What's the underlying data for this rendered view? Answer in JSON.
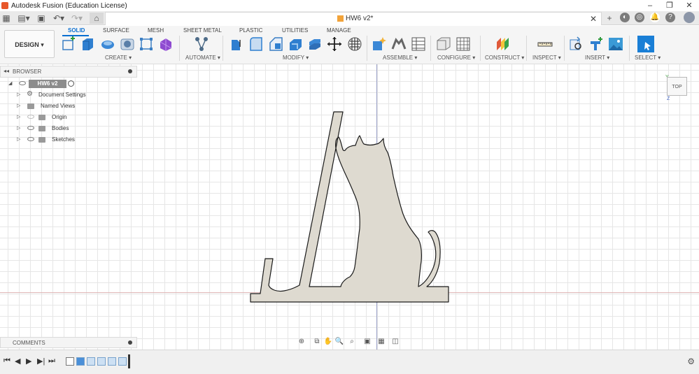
{
  "titlebar": {
    "title": "Autodesk Fusion (Education License)",
    "controls": [
      "–",
      "❐",
      "✕"
    ]
  },
  "document_tab": {
    "title": "HW6 v2*",
    "close": "✕"
  },
  "ribbon": {
    "workspace": "DESIGN ▾",
    "tabs": [
      "SOLID",
      "SURFACE",
      "MESH",
      "SHEET METAL",
      "PLASTIC",
      "UTILITIES",
      "MANAGE"
    ],
    "active_tab": "SOLID",
    "groups": [
      "CREATE ▾",
      "AUTOMATE ▾",
      "MODIFY ▾",
      "ASSEMBLE ▾",
      "CONFIGURE ▾",
      "CONSTRUCT ▾",
      "INSPECT ▾",
      "INSERT ▾",
      "SELECT ▾"
    ]
  },
  "browser": {
    "title": "BROWSER",
    "root": "HW6 v2",
    "items": [
      "Document Settings",
      "Named Views",
      "Origin",
      "Bodies",
      "Sketches"
    ]
  },
  "comments": {
    "title": "COMMENTS"
  },
  "viewcube": {
    "face": "TOP",
    "axis_y": "Y",
    "axis_z": "Z"
  },
  "colors": {
    "accent": "#0a6fd1",
    "part_fill": "#dedad0",
    "part_stroke": "#1a1a1a",
    "logo": "#e8572a"
  }
}
